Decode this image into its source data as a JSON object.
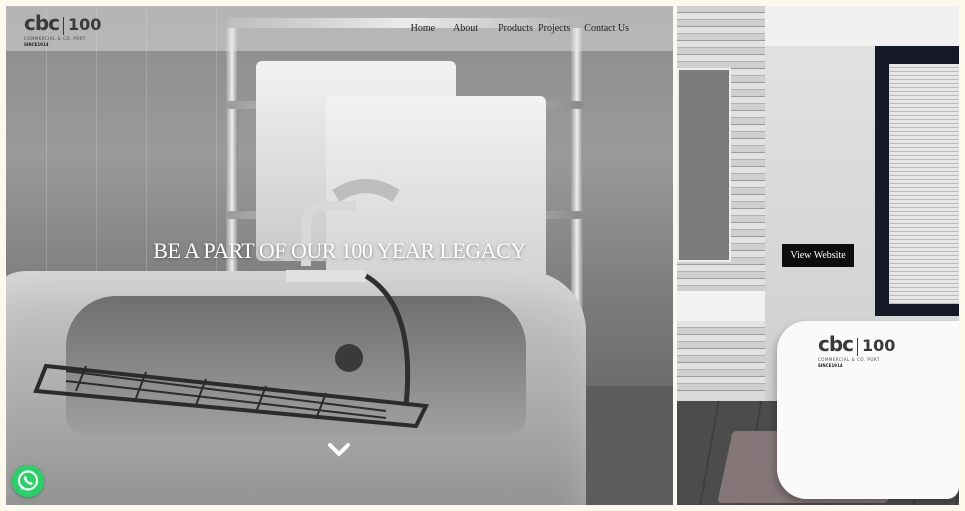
{
  "brand": {
    "logo_letters": "cbc",
    "logo_number": "100",
    "logo_sub": "COMMERCIAL & CO. PORT",
    "since": "SINCE1914"
  },
  "nav": {
    "items": [
      "Home",
      "About",
      "Products",
      "Projects",
      "Contact Us"
    ]
  },
  "hero": {
    "headline": "BE A PART OF OUR 100 YEAR LEGACY",
    "scroll_icon": "chevron-down-icon"
  },
  "side_panel": {
    "button_label": "View Website",
    "logo_letters": "cbc",
    "logo_number": "100",
    "logo_sub": "COMMERCIAL & CO. PORT",
    "since": "SINCE1914"
  },
  "floating": {
    "whatsapp_icon": "whatsapp-icon",
    "whatsapp_color": "#25d366"
  },
  "colors": {
    "background": "#fbf8ec",
    "button_bg": "#0d0d0d",
    "headline": "#ffffff"
  }
}
